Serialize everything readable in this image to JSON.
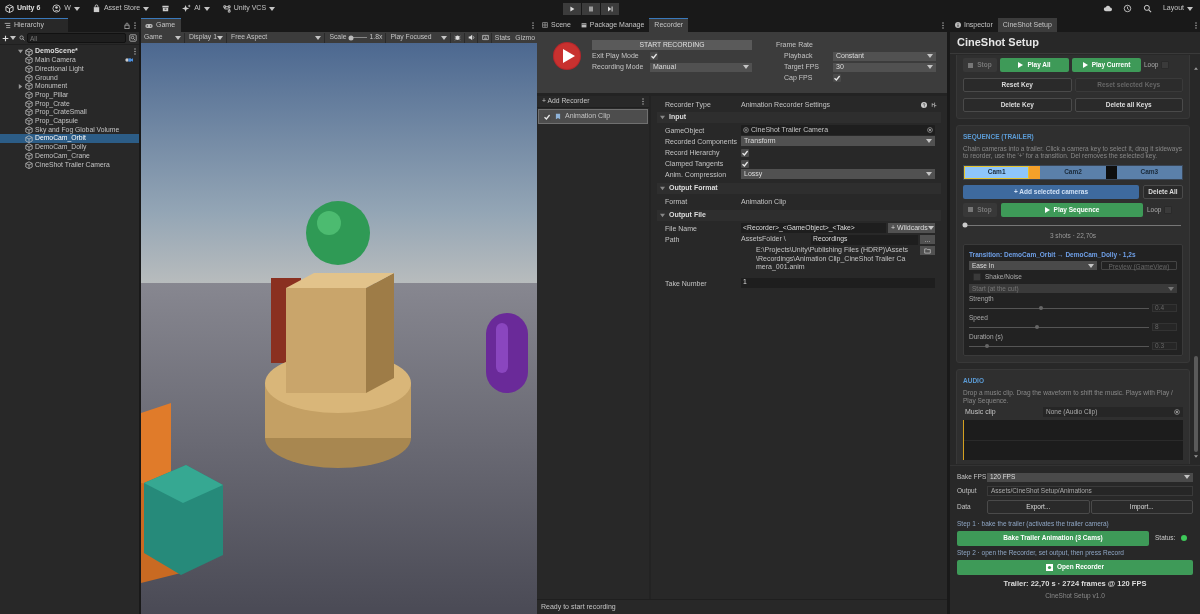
{
  "toolbar": {
    "left": [
      {
        "kind": "logo",
        "label": "Unity 6"
      },
      {
        "kind": "account",
        "label": "W"
      },
      {
        "kind": "store",
        "label": "Asset Store"
      },
      {
        "kind": "archive"
      },
      {
        "kind": "ai",
        "label": "AI"
      },
      {
        "kind": "vcs",
        "label": "Unity VCS"
      }
    ],
    "play": [
      {
        "kind": "play",
        "on": false
      },
      {
        "kind": "pause",
        "on": false
      },
      {
        "kind": "step",
        "on": false
      }
    ],
    "right": [
      {
        "kind": "cloud"
      },
      {
        "kind": "history"
      },
      {
        "kind": "search"
      },
      {
        "kind": "layout",
        "label": "Layout"
      }
    ]
  },
  "hierarchy": {
    "tab": "Hierarchy",
    "search_placeholder": "All",
    "scene": "DemoScene*",
    "items": [
      {
        "name": "Main Camera",
        "kind": "camera",
        "selected": false
      },
      {
        "name": "Directional Light",
        "kind": "object",
        "selected": false
      },
      {
        "name": "Ground",
        "kind": "object",
        "selected": false
      },
      {
        "name": "Monument",
        "kind": "group",
        "selected": false
      },
      {
        "name": "Prop_Pillar",
        "kind": "object",
        "selected": false
      },
      {
        "name": "Prop_Crate",
        "kind": "object",
        "selected": false
      },
      {
        "name": "Prop_CrateSmall",
        "kind": "object",
        "selected": false
      },
      {
        "name": "Prop_Capsule",
        "kind": "object",
        "selected": false
      },
      {
        "name": "Sky and Fog Global Volume",
        "kind": "object",
        "selected": false
      },
      {
        "name": "DemoCam_Orbit",
        "kind": "object",
        "selected": true
      },
      {
        "name": "DemoCam_Dolly",
        "kind": "object",
        "selected": false
      },
      {
        "name": "DemoCam_Crane",
        "kind": "object",
        "selected": false
      },
      {
        "name": "CineShot Trailer Camera",
        "kind": "object",
        "selected": false
      }
    ]
  },
  "game": {
    "tab": "Game",
    "toolbar": [
      {
        "kind": "dropdown",
        "label": "Game"
      },
      {
        "kind": "dropdown",
        "label": "Display 1"
      },
      {
        "kind": "dropdown",
        "label": "Free Aspect"
      },
      {
        "kind": "scale",
        "label": "Scale",
        "level": 0.1,
        "reading": "1.8x"
      },
      {
        "kind": "dropdown",
        "label": "Play Focused"
      },
      {
        "kind": "debug"
      },
      {
        "kind": "audio"
      },
      {
        "kind": "keyboard"
      },
      {
        "kind": "text",
        "label": "Stats"
      },
      {
        "kind": "text",
        "label": "Gizmo"
      }
    ]
  },
  "recorder": {
    "tabs": [
      {
        "label": "Scene",
        "kind": "scene",
        "selected": false
      },
      {
        "label": "Package Manage",
        "kind": "package",
        "selected": false
      },
      {
        "label": "Recorder",
        "kind": "plain",
        "selected": true
      }
    ],
    "start_button": "START RECORDING",
    "exit_play_mode": {
      "label": "Exit Play Mode",
      "checked": true
    },
    "recording_mode": {
      "label": "Recording Mode",
      "value": "Manual"
    },
    "frame_rate": {
      "label": "Frame Rate",
      "playback": {
        "label": "Playback",
        "value": "Constant"
      },
      "target_fps": {
        "label": "Target FPS",
        "value": "30"
      },
      "cap_fps": {
        "label": "Cap FPS",
        "checked": true
      }
    },
    "add_recorder": "+ Add Recorder",
    "recorders": [
      {
        "name": "Animation Clip",
        "checked": true,
        "selected": true
      }
    ],
    "recorder_type": {
      "label": "Recorder Type",
      "value": "Animation Recorder Settings"
    },
    "sections": [
      {
        "title": "Input",
        "expanded": true,
        "fields": [
          {
            "kind": "object",
            "label": "GameObject",
            "value": "CineShot Trailer Camera"
          },
          {
            "kind": "dropdown",
            "label": "Recorded Components",
            "value": "Transform"
          },
          {
            "kind": "checkbox",
            "label": "Record Hierarchy",
            "checked": true
          },
          {
            "kind": "checkbox",
            "label": "Clamped Tangents",
            "checked": true
          },
          {
            "kind": "dropdown",
            "label": "Anim. Compression",
            "value": "Lossy"
          }
        ]
      },
      {
        "title": "Output Format",
        "expanded": true,
        "fields": [
          {
            "kind": "text",
            "label": "Format",
            "value": "Animation Clip"
          }
        ]
      },
      {
        "title": "Output File",
        "expanded": true,
        "fields": [
          {
            "kind": "filename",
            "label": "File Name",
            "value": "<Recorder>_<GameObject>_<Take>",
            "button": "+ Wildcards"
          },
          {
            "kind": "path",
            "label": "Path",
            "prefix": "AssetsFolder \\",
            "value": "Recordings",
            "button": "...",
            "full_path": "E:\\Projects\\Unity\\Publishing Files (HDRP)\\Assets\\Recordings\\Animation Clip_CineShot Trailer Camera_001.anim"
          },
          {
            "kind": "input",
            "label": "Take Number",
            "value": "1"
          }
        ]
      }
    ],
    "status": "Ready to start recording"
  },
  "inspector": {
    "tabs": [
      {
        "label": "Inspector",
        "kind": "info",
        "selected": false
      },
      {
        "label": "CineShot Setup",
        "kind": "plain",
        "selected": true
      }
    ],
    "title": "CineShot Setup",
    "playback": {
      "buttons": [
        {
          "label": "Stop",
          "kind": "stop",
          "disabled": true
        },
        {
          "label": "Play All",
          "kind": "play",
          "disabled": false
        },
        {
          "label": "Play Current",
          "kind": "play",
          "disabled": false
        }
      ],
      "loop": {
        "label": "Loop",
        "checked": false
      }
    },
    "key_buttons": [
      {
        "label": "Reset Key",
        "disabled": false
      },
      {
        "label": "Reset selected Keys",
        "disabled": true
      },
      {
        "label": "Delete Key",
        "disabled": false
      },
      {
        "label": "Delete all Keys",
        "disabled": false
      }
    ],
    "sequence": {
      "heading": "SEQUENCE (TRAILER)",
      "description": "Chain cameras into a trailer. Click a camera key to select it, drag it sideways to reorder, use the '+' for a transition. Del removes the selected key.",
      "segments": [
        {
          "kind": "camera",
          "label": "Cam1",
          "color": "#8ec6fb",
          "selected": true
        },
        {
          "kind": "transition",
          "color": "#f4a02a",
          "selected": false
        },
        {
          "kind": "camera",
          "label": "Cam2",
          "color": "#5b80aa",
          "selected": false
        },
        {
          "kind": "transition",
          "color": "#0e0e0e",
          "selected": false
        },
        {
          "kind": "camera",
          "label": "Cam3",
          "color": "#5b80aa",
          "selected": false
        }
      ],
      "add_button": "+ Add selected cameras",
      "delete_button": "Delete All",
      "stop_button": {
        "label": "Stop",
        "disabled": true
      },
      "play_button": "Play Sequence",
      "loop": {
        "label": "Loop",
        "checked": false
      },
      "scrub": {
        "level": 0
      },
      "summary": "3 shots  ·  22,70s",
      "transition": {
        "title": "Transition:  DemoCam_Orbit  →  DemoCam_Dolly  ·  1,2s",
        "easing": "Ease In",
        "preview_button": {
          "label": "Preview (GameView)",
          "disabled": true
        },
        "shake": {
          "label": "Shake/Noise",
          "checked": false
        },
        "shake_start": {
          "value": "Start (at the cut)",
          "disabled": true
        },
        "sliders": [
          {
            "label": "Strength",
            "level": 0.4,
            "reading": "0.4"
          },
          {
            "label": "Speed",
            "level": 0.38,
            "reading": "8"
          },
          {
            "label": "Duration (s)",
            "level": 0.1,
            "reading": "0.3"
          }
        ]
      }
    },
    "audio": {
      "heading": "AUDIO",
      "description": "Drop a music clip. Drag the waveform to shift the music. Plays with Play / Play Sequence.",
      "music_label": "Music clip",
      "music_value": "None (Audio Clip)"
    },
    "bake_fps": {
      "label": "Bake FPS",
      "value": "120 FPS"
    },
    "output": {
      "label": "Output",
      "value": "Assets/CineShot Setup/Animations"
    },
    "data": {
      "label": "Data",
      "buttons": [
        "Export...",
        "Import..."
      ]
    },
    "step1": "Step 1  ·  bake the trailer (activates the trailer camera)",
    "bake_button": "Bake Trailer Animation (3 Cams)",
    "status": {
      "label": "Status:",
      "color": "#3ec95a"
    },
    "step2": "Step 2  ·  open the Recorder, set output, then press Record",
    "open_button": "Open Recorder",
    "summary": "Trailer: 22,70 s  ·  2724 frames @ 120 FPS",
    "version": "CineShot Setup v1.0"
  }
}
